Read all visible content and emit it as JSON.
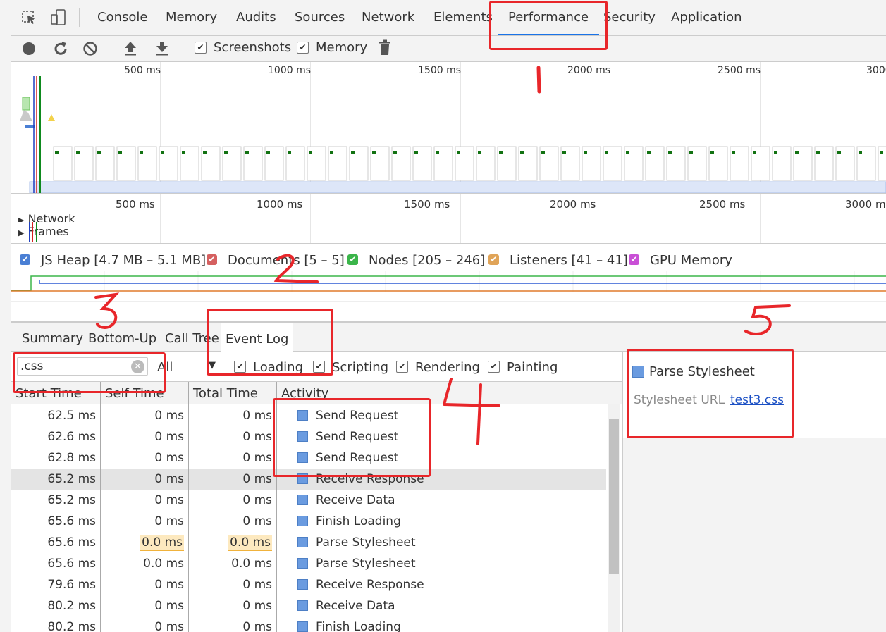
{
  "top_tabs": [
    "Console",
    "Memory",
    "Audits",
    "Sources",
    "Network",
    "Elements",
    "Performance",
    "Security",
    "Application"
  ],
  "active_top_tab": "Performance",
  "toolbar": {
    "screenshots_label": "Screenshots",
    "memory_label": "Memory",
    "screenshots_checked": true,
    "memory_checked": true
  },
  "overview_ticks": [
    "500 ms",
    "1000 ms",
    "1500 ms",
    "2000 ms",
    "2500 ms",
    "3000 ms"
  ],
  "ruler_ticks": [
    "500 ms",
    "1000 ms",
    "1500 ms",
    "2000 ms",
    "2500 ms",
    "3000 ms"
  ],
  "tracks": {
    "network": "Network",
    "frames": "Frames"
  },
  "counters": [
    {
      "label": "JS Heap [4.7 MB – 5.1 MB]",
      "color": "#4a7fd4"
    },
    {
      "label": "Documents [5 – 5]",
      "color": "#d56060"
    },
    {
      "label": "Nodes [205 – 246]",
      "color": "#3bb54a"
    },
    {
      "label": "Listeners [41 – 41]",
      "color": "#e0a458"
    },
    {
      "label": "GPU Memory",
      "color": "#c94fd6"
    }
  ],
  "bottom_tabs": [
    "Summary",
    "Bottom-Up",
    "Call Tree",
    "Event Log"
  ],
  "active_bottom_tab": "Event Log",
  "filter": {
    "search_value": ".css",
    "duration_label": "All",
    "categories": [
      "Loading",
      "Scripting",
      "Rendering",
      "Painting"
    ]
  },
  "table": {
    "columns": [
      "Start Time",
      "Self Time",
      "Total Time",
      "Activity"
    ],
    "rows": [
      {
        "start": "62.5 ms",
        "self": "0 ms",
        "total": "0 ms",
        "activity": "Send Request"
      },
      {
        "start": "62.6 ms",
        "self": "0 ms",
        "total": "0 ms",
        "activity": "Send Request"
      },
      {
        "start": "62.8 ms",
        "self": "0 ms",
        "total": "0 ms",
        "activity": "Send Request"
      },
      {
        "start": "65.2 ms",
        "self": "0 ms",
        "total": "0 ms",
        "activity": "Receive Response"
      },
      {
        "start": "65.2 ms",
        "self": "0 ms",
        "total": "0 ms",
        "activity": "Receive Data"
      },
      {
        "start": "65.6 ms",
        "self": "0 ms",
        "total": "0 ms",
        "activity": "Finish Loading"
      },
      {
        "start": "65.6 ms",
        "self": "0.0 ms",
        "total": "0.0 ms",
        "activity": "Parse Stylesheet"
      },
      {
        "start": "65.6 ms",
        "self": "0.0 ms",
        "total": "0.0 ms",
        "activity": "Parse Stylesheet"
      },
      {
        "start": "79.6 ms",
        "self": "0 ms",
        "total": "0 ms",
        "activity": "Receive Response"
      },
      {
        "start": "80.2 ms",
        "self": "0 ms",
        "total": "0 ms",
        "activity": "Receive Data"
      },
      {
        "start": "80.2 ms",
        "self": "0 ms",
        "total": "0 ms",
        "activity": "Finish Loading"
      }
    ]
  },
  "details": {
    "title": "Parse Stylesheet",
    "field_label": "Stylesheet URL",
    "field_value": "test3.css"
  }
}
